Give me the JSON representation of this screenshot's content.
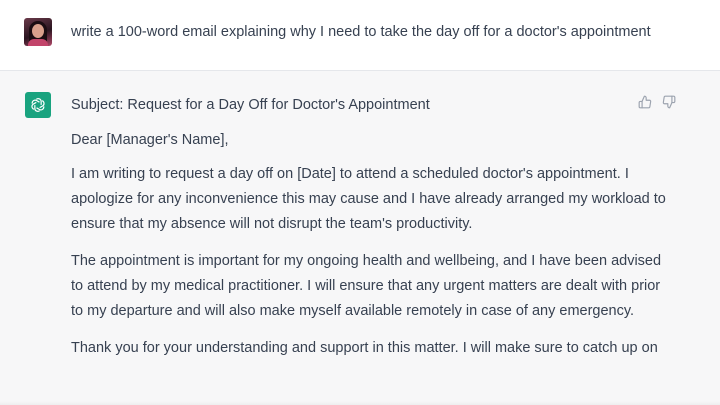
{
  "user_message": {
    "avatar": "user-avatar",
    "text": "write a 100-word email explaining why I need to take the day off for a doctor's appointment"
  },
  "assistant_message": {
    "avatar": "openai-logo-icon",
    "avatar_color": "#19a37f",
    "subject": "Subject: Request for a Day Off for Doctor's Appointment",
    "greeting": "Dear [Manager's Name],",
    "paragraphs": [
      "I am writing to request a day off on [Date] to attend a scheduled doctor's appointment. I apologize for any inconvenience this may cause and I have already arranged my workload to ensure that my absence will not disrupt the team's productivity.",
      "The appointment is important for my ongoing health and wellbeing, and I have been advised to attend by my medical practitioner. I will ensure that any urgent matters are dealt with prior to my departure and will also make myself available remotely in case of any emergency.",
      "Thank you for your understanding and support in this matter. I will make sure to catch up on"
    ],
    "feedback": {
      "like_icon": "thumbs-up-icon",
      "dislike_icon": "thumbs-down-icon"
    }
  },
  "colors": {
    "text": "#374151",
    "assistant_background": "#f7f7f8",
    "user_background": "#ffffff",
    "accent": "#19a37f"
  }
}
